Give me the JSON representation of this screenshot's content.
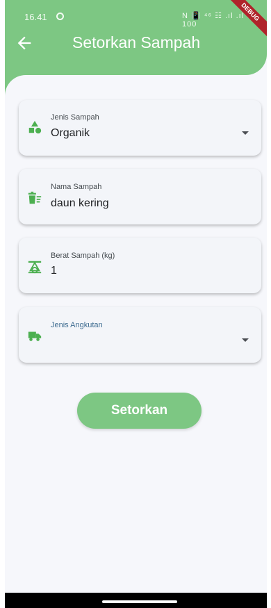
{
  "status_bar": {
    "time": "16.41",
    "right_icons_text": "N 📳 ⁴⁶ ☷ .ıl .ıl O 100",
    "debug_label": "DEBUG"
  },
  "appbar": {
    "title": "Setorkan Sampah",
    "back_icon": "arrow-left-icon"
  },
  "form": {
    "jenis_sampah": {
      "label": "Jenis Sampah",
      "value": "Organik",
      "icon": "category-shapes-icon"
    },
    "nama_sampah": {
      "label": "Nama Sampah",
      "value": "daun kering",
      "icon": "trash-list-icon"
    },
    "berat_sampah": {
      "label": "Berat Sampah (kg)",
      "value": "1",
      "icon": "scale-icon"
    },
    "jenis_angkutan": {
      "label": "Jenis Angkutan",
      "value": "",
      "icon": "truck-icon"
    }
  },
  "submit": {
    "label": "Setorkan"
  },
  "colors": {
    "primary": "#7dc783",
    "icon_green": "#4caf50",
    "label_blue": "#3b6a8f",
    "background": "#f6f7fb"
  }
}
